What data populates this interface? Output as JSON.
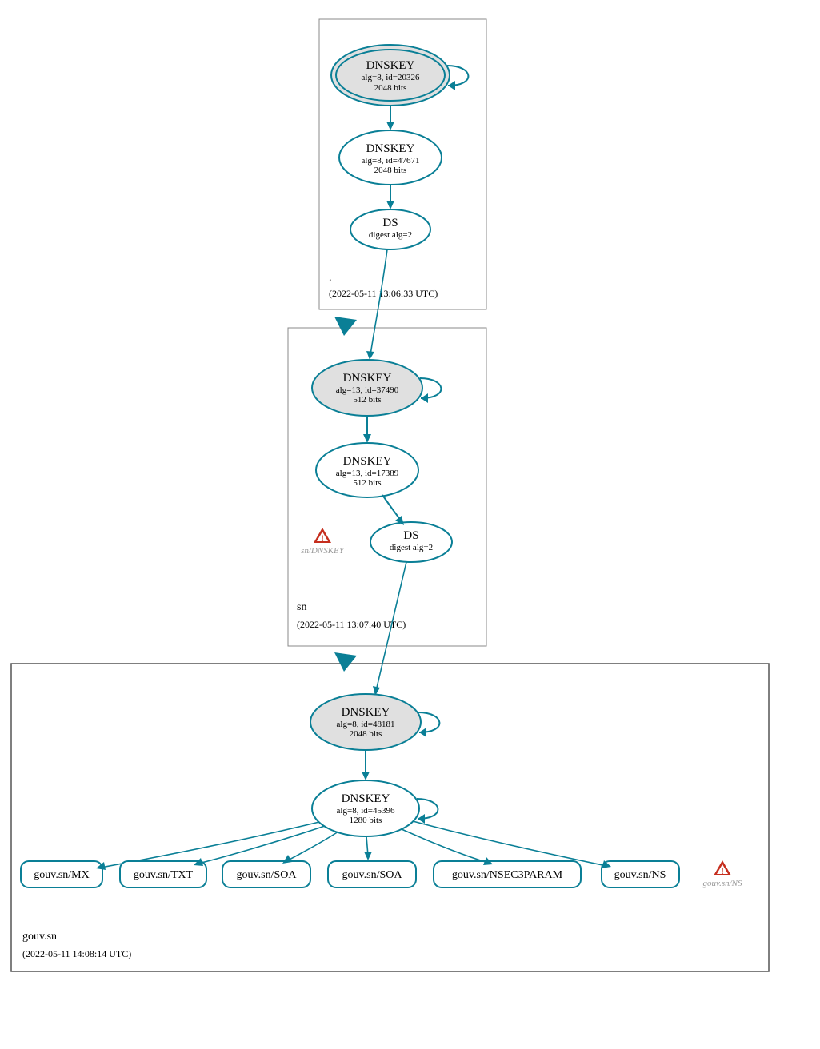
{
  "zones": {
    "root": {
      "label": ".",
      "timestamp": "(2022-05-11 13:06:33 UTC)",
      "ksk": {
        "title": "DNSKEY",
        "line1": "alg=8, id=20326",
        "line2": "2048 bits"
      },
      "zsk": {
        "title": "DNSKEY",
        "line1": "alg=8, id=47671",
        "line2": "2048 bits"
      },
      "ds": {
        "title": "DS",
        "line1": "digest alg=2"
      }
    },
    "sn": {
      "label": "sn",
      "timestamp": "(2022-05-11 13:07:40 UTC)",
      "ksk": {
        "title": "DNSKEY",
        "line1": "alg=13, id=37490",
        "line2": "512 bits"
      },
      "zsk": {
        "title": "DNSKEY",
        "line1": "alg=13, id=17389",
        "line2": "512 bits"
      },
      "ds": {
        "title": "DS",
        "line1": "digest alg=2"
      },
      "warn": {
        "label": "sn/DNSKEY"
      }
    },
    "gouv": {
      "label": "gouv.sn",
      "timestamp": "(2022-05-11 14:08:14 UTC)",
      "ksk": {
        "title": "DNSKEY",
        "line1": "alg=8, id=48181",
        "line2": "2048 bits"
      },
      "zsk": {
        "title": "DNSKEY",
        "line1": "alg=8, id=45396",
        "line2": "1280 bits"
      },
      "rrsets": {
        "mx": "gouv.sn/MX",
        "txt": "gouv.sn/TXT",
        "soa1": "gouv.sn/SOA",
        "soa2": "gouv.sn/SOA",
        "nsec3param": "gouv.sn/NSEC3PARAM",
        "ns": "gouv.sn/NS"
      },
      "warn": {
        "label": "gouv.sn/NS"
      }
    }
  },
  "colors": {
    "stroke": "#0a7f96",
    "warn": "#c62e1e"
  }
}
